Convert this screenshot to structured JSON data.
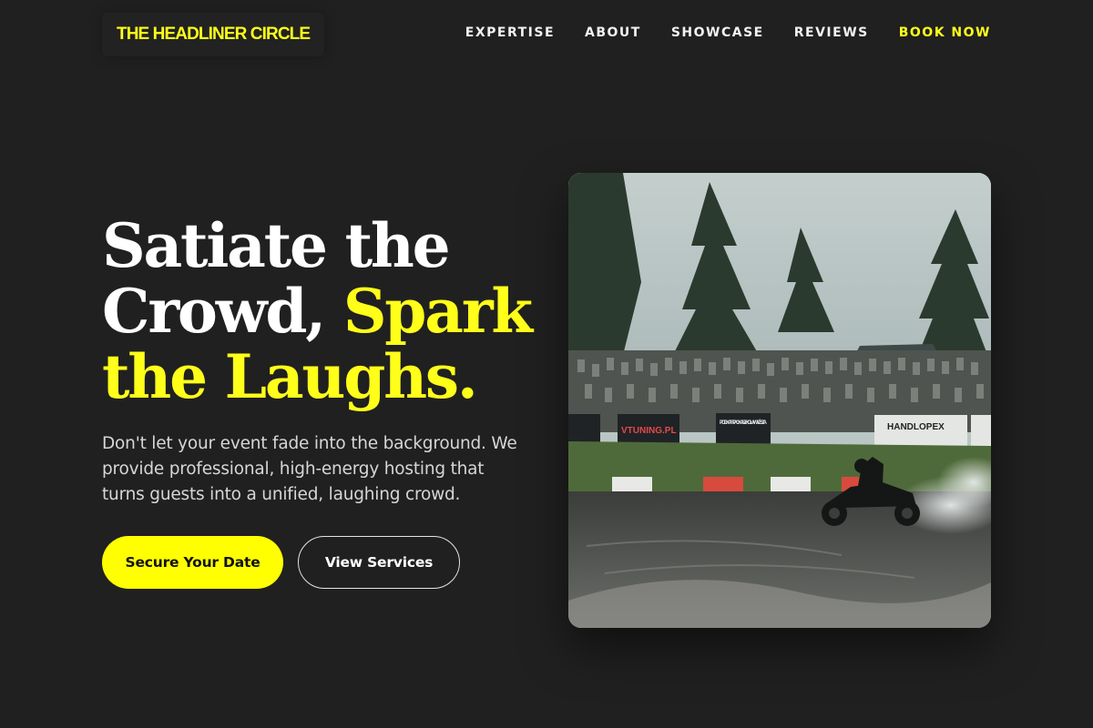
{
  "brand": {
    "logo_text": "THE HEADLINER CIRCLE",
    "accent_color": "#ffff1a",
    "background_color": "#202020"
  },
  "nav": {
    "items": [
      {
        "label": "EXPERTISE"
      },
      {
        "label": "ABOUT"
      },
      {
        "label": "SHOWCASE"
      },
      {
        "label": "REVIEWS"
      }
    ],
    "cta_label": "BOOK NOW"
  },
  "hero": {
    "title_part1": "Satiate the Crowd, ",
    "title_accent": "Spark the Laughs.",
    "description": "Don't let your event fade into the background. We provide professional, high-energy hosting that turns guests into a unified, laughing crowd.",
    "primary_button": "Secure Your Date",
    "secondary_button": "View Services",
    "image": {
      "banners": [
        "VTUNING.PL",
        "PODKARPACKA SZKOŁA WYŻSZA",
        "HANDLOPEX"
      ]
    }
  }
}
